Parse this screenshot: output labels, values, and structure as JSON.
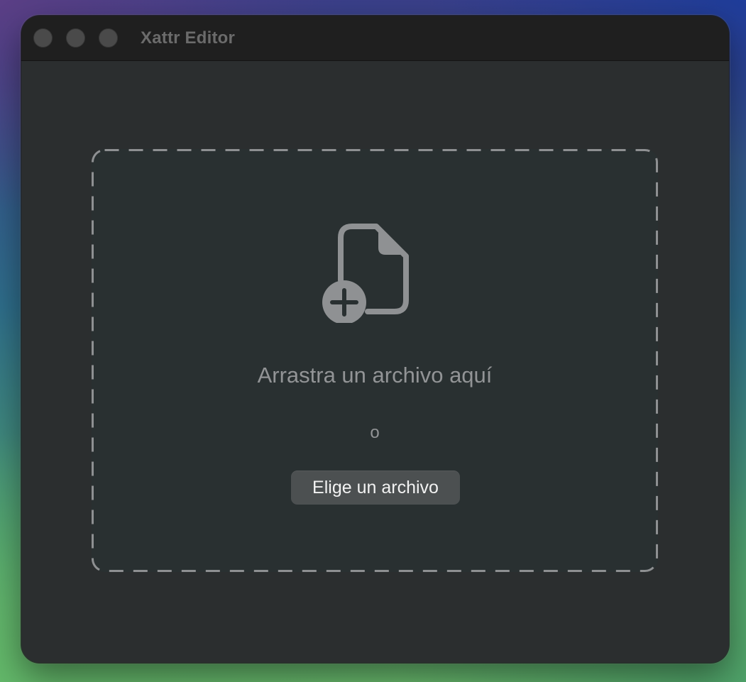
{
  "window": {
    "title": "Xattr Editor"
  },
  "dropzone": {
    "icon": "doc-badge-plus-icon",
    "prompt": "Arrastra un archivo aquí",
    "separator": "o",
    "choose_button_label": "Elige un archivo"
  },
  "colors": {
    "window_bg": "#2b2e2f",
    "titlebar_bg": "#1f1f1f",
    "dropzone_border": "#8e9092",
    "text_secondary": "#929496",
    "button_bg": "#4c5051"
  }
}
